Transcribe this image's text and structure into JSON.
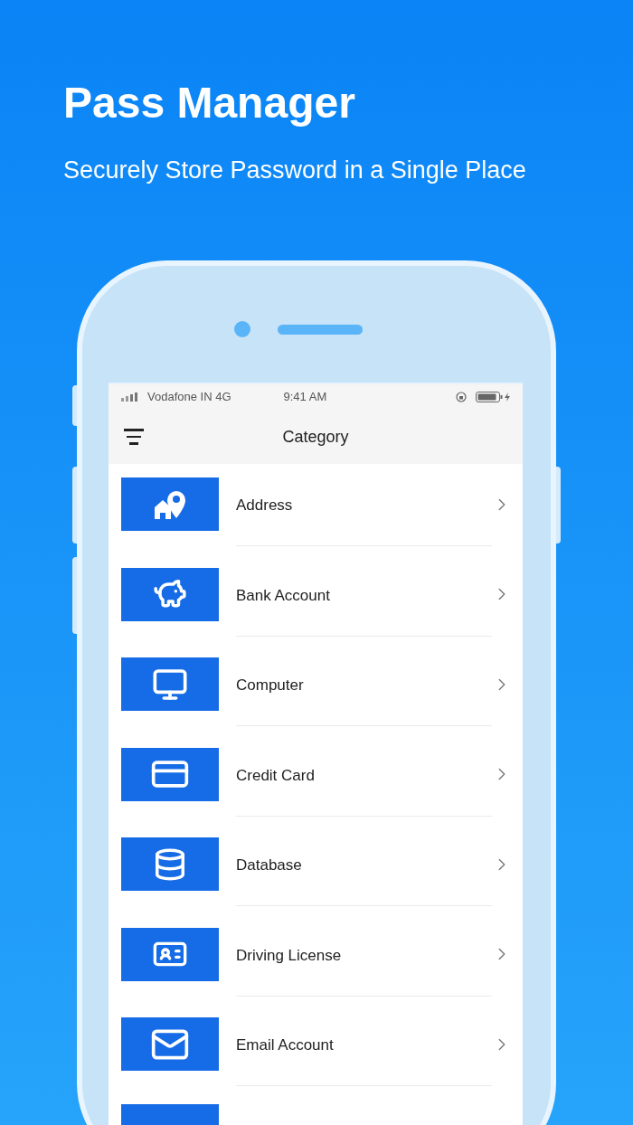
{
  "headline": {
    "title": "Pass Manager",
    "subtitle": "Securely Store Password in a Single Place"
  },
  "status_bar": {
    "carrier": "Vodafone IN 4G",
    "time": "9:41 AM"
  },
  "nav_bar": {
    "title": "Category"
  },
  "categories": [
    {
      "label": "Address"
    },
    {
      "label": "Bank Account"
    },
    {
      "label": "Computer"
    },
    {
      "label": "Credit Card"
    },
    {
      "label": "Database"
    },
    {
      "label": "Driving License"
    },
    {
      "label": "Email Account"
    }
  ]
}
